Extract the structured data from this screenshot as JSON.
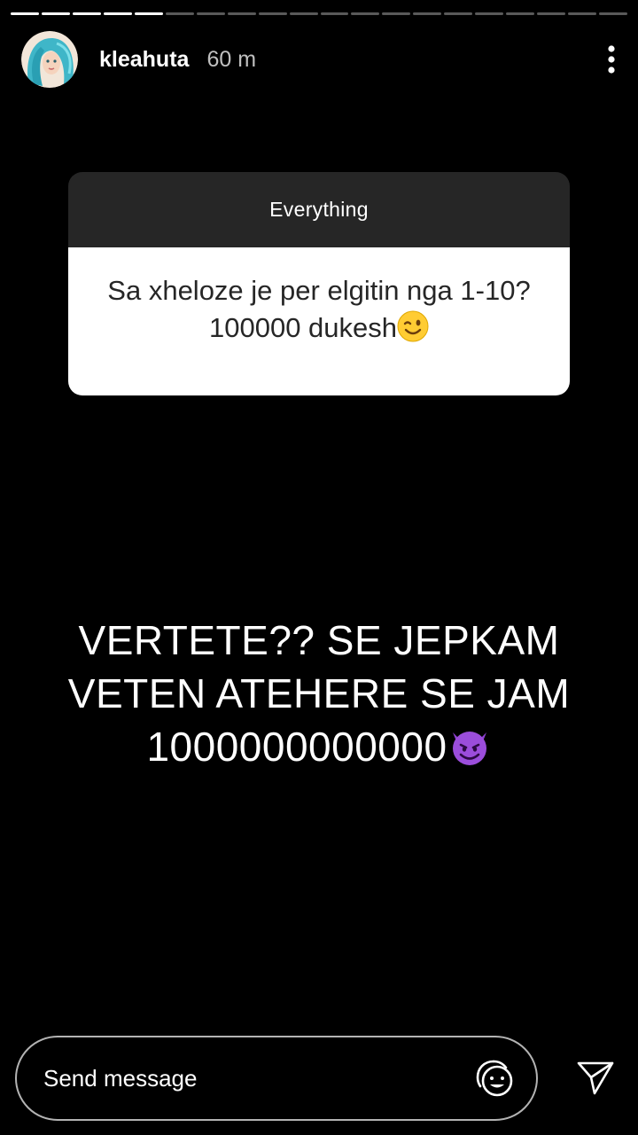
{
  "story": {
    "segments_total": 20,
    "segments_viewed": 5,
    "user": {
      "username": "kleahuta",
      "time_ago": "60 m"
    }
  },
  "question_sticker": {
    "header": "Everything",
    "question": "Sa xheloze je per elgitin nga 1-10? 100000 dukesh",
    "emoji": "winking-face"
  },
  "caption": {
    "line1": "VERTETE?? SE JEPKAM",
    "line2": "VETEN ATEHERE SE JAM",
    "line3": "1000000000000",
    "emoji": "smiling-devil"
  },
  "footer": {
    "placeholder": "Send message",
    "sticker_icon": "face-sticker-icon",
    "send_icon": "paper-plane-icon"
  },
  "colors": {
    "background": "#000000",
    "sticker_header": "#262626",
    "sticker_body": "#ffffff",
    "text": "#ffffff"
  }
}
